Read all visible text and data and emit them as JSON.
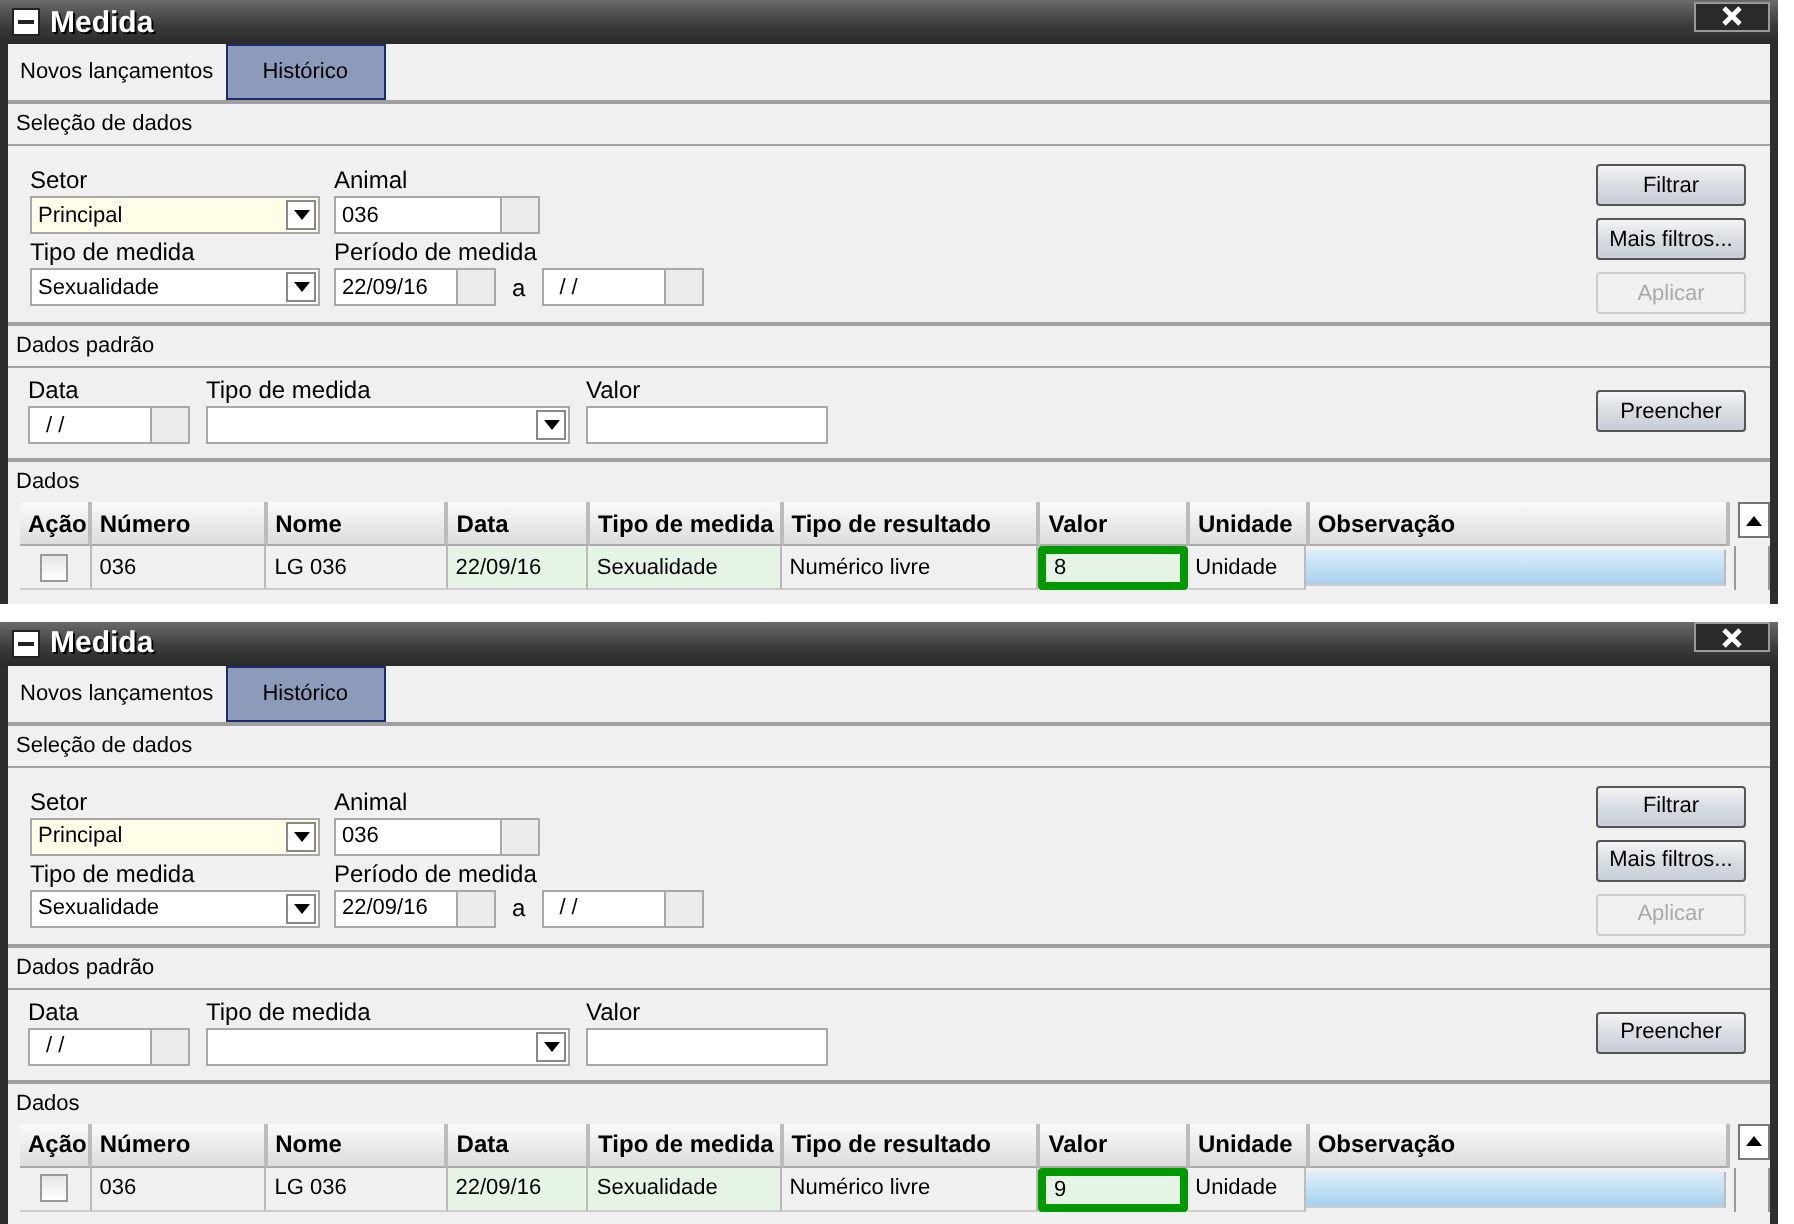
{
  "panels": [
    {
      "window": {
        "title": "Medida"
      },
      "tabs": [
        {
          "label": "Novos lançamentos",
          "selected": true
        },
        {
          "label": "Histórico",
          "selected": false
        }
      ],
      "selecao": {
        "title": "Seleção de dados",
        "setor": {
          "label": "Setor",
          "value": "Principal"
        },
        "animal": {
          "label": "Animal",
          "value": "036"
        },
        "tipo": {
          "label": "Tipo de medida",
          "value": "Sexualidade"
        },
        "periodo": {
          "label": "Período de medida",
          "from": "22/09/16",
          "separator": "a",
          "to": "/ /"
        },
        "buttons": [
          {
            "label": "Filtrar",
            "disabled": false
          },
          {
            "label": "Mais filtros...",
            "disabled": false
          },
          {
            "label": "Aplicar",
            "disabled": true
          }
        ]
      },
      "padrao": {
        "title": "Dados padrão",
        "data": {
          "label": "Data",
          "value": "/ /"
        },
        "tipo": {
          "label": "Tipo de medida"
        },
        "valor": {
          "label": "Valor"
        },
        "button": {
          "label": "Preencher",
          "disabled": false
        }
      },
      "dados": {
        "title": "Dados",
        "columns": [
          "Ação",
          "Número",
          "Nome",
          "Data",
          "Tipo de medida",
          "Tipo de resultado",
          "Valor",
          "Unidade",
          "Observação"
        ],
        "rows": [
          {
            "cells": [
              {
                "kind": "check",
                "checked": false,
                "highlighted": false
              },
              {
                "text": "036",
                "kind": "plain",
                "highlighted": false
              },
              {
                "text": "LG 036",
                "kind": "plain",
                "highlighted": false
              },
              {
                "text": "22/09/16",
                "kind": "editable",
                "highlighted": false
              },
              {
                "text": "Sexualidade",
                "kind": "editable",
                "highlighted": false
              },
              {
                "text": "Numérico livre",
                "kind": "plain",
                "highlighted": false
              },
              {
                "text": "8",
                "kind": "editable",
                "highlighted": true
              },
              {
                "text": "Unidade",
                "kind": "plain",
                "highlighted": false
              },
              {
                "kind": "memo",
                "highlighted": false
              }
            ]
          }
        ]
      }
    },
    {
      "window": {
        "title": "Medida"
      },
      "tabs": [
        {
          "label": "Novos lançamentos",
          "selected": true
        },
        {
          "label": "Histórico",
          "selected": false
        }
      ],
      "selecao": {
        "title": "Seleção de dados",
        "setor": {
          "label": "Setor",
          "value": "Principal"
        },
        "animal": {
          "label": "Animal",
          "value": "036"
        },
        "tipo": {
          "label": "Tipo de medida",
          "value": "Sexualidade"
        },
        "periodo": {
          "label": "Período de medida",
          "from": "22/09/16",
          "separator": "a",
          "to": "/ /"
        },
        "buttons": [
          {
            "label": "Filtrar",
            "disabled": false
          },
          {
            "label": "Mais filtros...",
            "disabled": false
          },
          {
            "label": "Aplicar",
            "disabled": true
          }
        ]
      },
      "padrao": {
        "title": "Dados padrão",
        "data": {
          "label": "Data",
          "value": "/ /"
        },
        "tipo": {
          "label": "Tipo de medida"
        },
        "valor": {
          "label": "Valor"
        },
        "button": {
          "label": "Preencher",
          "disabled": false
        }
      },
      "dados": {
        "title": "Dados",
        "columns": [
          "Ação",
          "Número",
          "Nome",
          "Data",
          "Tipo de medida",
          "Tipo de resultado",
          "Valor",
          "Unidade",
          "Observação"
        ],
        "rows": [
          {
            "cells": [
              {
                "kind": "check",
                "checked": false,
                "highlighted": false
              },
              {
                "text": "036",
                "kind": "plain",
                "highlighted": false
              },
              {
                "text": "LG 036",
                "kind": "plain",
                "highlighted": false
              },
              {
                "text": "22/09/16",
                "kind": "editable",
                "highlighted": false
              },
              {
                "text": "Sexualidade",
                "kind": "editable",
                "highlighted": false
              },
              {
                "text": "Numérico livre",
                "kind": "plain",
                "highlighted": false
              },
              {
                "text": "9",
                "kind": "editable",
                "highlighted": true
              },
              {
                "text": "Unidade",
                "kind": "plain",
                "highlighted": false
              },
              {
                "kind": "memo",
                "highlighted": false
              }
            ]
          }
        ]
      }
    }
  ]
}
